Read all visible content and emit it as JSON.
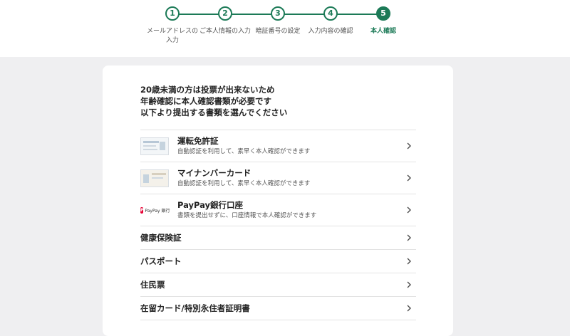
{
  "stepper": {
    "steps": [
      {
        "number": "1",
        "label": "メールアドレスの入力"
      },
      {
        "number": "2",
        "label": "ご本人情報の入力"
      },
      {
        "number": "3",
        "label": "暗証番号の設定"
      },
      {
        "number": "4",
        "label": "入力内容の確認"
      },
      {
        "number": "5",
        "label": "本人確認"
      }
    ],
    "current": 5,
    "accent_color": "#1c7a57"
  },
  "intro": {
    "line1": "20歳未満の方は投票が出来ないため",
    "line2": "年齢確認に本人確認書類が必要です",
    "line3": "以下より提出する書類を選んでください"
  },
  "documents": [
    {
      "title": "運転免許証",
      "subtitle": "自動認証を利用して、素早く本人確認ができます",
      "icon": "drivers-license-image"
    },
    {
      "title": "マイナンバーカード",
      "subtitle": "自動認証を利用して、素早く本人確認ができます",
      "icon": "my-number-card-image"
    },
    {
      "title": "PayPay銀行口座",
      "subtitle": "書類を提出せずに、口座情報で本人確認ができます",
      "icon": "paypay-bank-logo",
      "logo_text": "PayPay 銀行",
      "logo_mark": "P"
    },
    {
      "title": "健康保険証"
    },
    {
      "title": "パスポート"
    },
    {
      "title": "住民票"
    },
    {
      "title": "在留カード/特別永住者証明書"
    }
  ]
}
